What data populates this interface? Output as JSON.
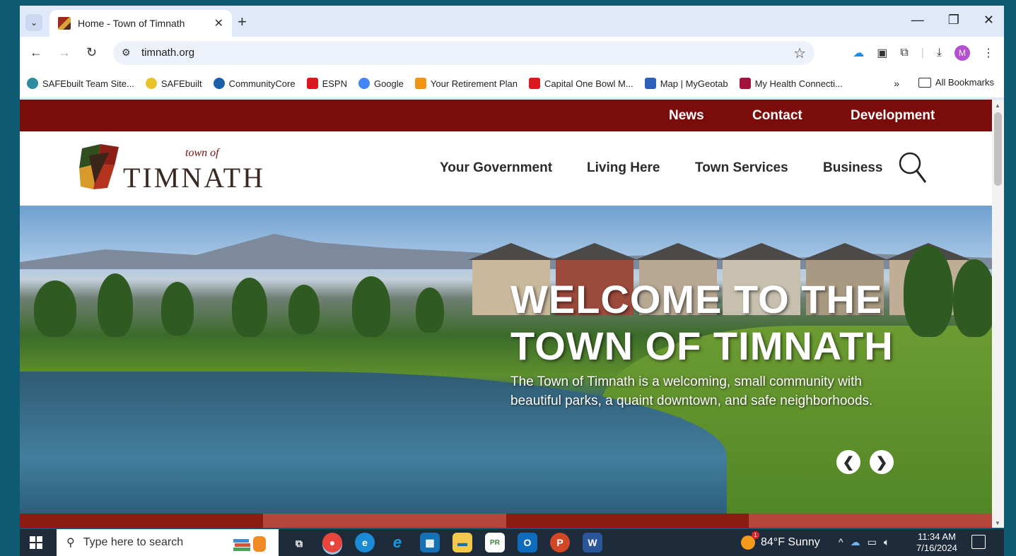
{
  "browser": {
    "tab_title": "Home - Town of Timnath",
    "tab_close": "✕",
    "new_tab": "+",
    "url": "timnath.org",
    "window": {
      "minimize": "—",
      "restore": "❐",
      "close": "✕"
    },
    "avatar_letter": "M",
    "bookmarks": [
      {
        "label": "SAFEbuilt Team Site...",
        "color": "#2d8c9e"
      },
      {
        "label": "SAFEbuilt",
        "color": "#e8c12b"
      },
      {
        "label": "CommunityCore",
        "color": "#1b5fab"
      },
      {
        "label": "ESPN",
        "color": "#d71920"
      },
      {
        "label": "Google",
        "color": "#4285f4"
      },
      {
        "label": "Your Retirement Plan",
        "color": "#f29314"
      },
      {
        "label": "Capital One Bowl M...",
        "color": "#d71920"
      },
      {
        "label": "Map | MyGeotab",
        "color": "#2f5fb8"
      },
      {
        "label": "My Health Connecti...",
        "color": "#a3123a"
      }
    ],
    "bookmarks_more": "»",
    "all_bookmarks": "All Bookmarks"
  },
  "site": {
    "top_links": [
      "News",
      "Contact",
      "Development"
    ],
    "logo": {
      "word": "TIMNATH",
      "script": "town of"
    },
    "nav": [
      "Your Government",
      "Living Here",
      "Town Services",
      "Business"
    ],
    "hero": {
      "title_line1": "WELCOME TO THE",
      "title_line2": "TOWN OF TIMNATH",
      "description": "The Town of Timnath is a welcoming, small community with beautiful parks, a quaint downtown, and safe neighborhoods.",
      "prev": "❮",
      "next": "❯"
    },
    "band_colors": [
      "#8b1a10",
      "#b5473a",
      "#8b1a10",
      "#b5473a"
    ],
    "colors": {
      "maroon": "#7a0c0c",
      "header_text": "#2b2b2b"
    }
  },
  "taskbar": {
    "search_placeholder": "Type here to search",
    "apps": [
      {
        "name": "task-view",
        "glyph": "⧉",
        "color": "transparent"
      },
      {
        "name": "chrome",
        "glyph": "●",
        "color": "#e8453c",
        "active": true
      },
      {
        "name": "edge",
        "glyph": "e",
        "color": "#1c8bd6"
      },
      {
        "name": "internet-explorer",
        "glyph": "e",
        "color": "#1b6ac2"
      },
      {
        "name": "store",
        "glyph": "▦",
        "color": "#1670b5"
      },
      {
        "name": "file-explorer",
        "glyph": "▬",
        "color": "#f2c94c"
      },
      {
        "name": "pr",
        "glyph": "PR",
        "color": "#3e7d3a"
      },
      {
        "name": "outlook",
        "glyph": "O",
        "color": "#0f6cbd"
      },
      {
        "name": "powerpoint",
        "glyph": "P",
        "color": "#d24726"
      },
      {
        "name": "word",
        "glyph": "W",
        "color": "#2b579a"
      }
    ],
    "weather": "84°F Sunny",
    "weather_badge": "1",
    "time": "11:34 AM",
    "date": "7/16/2024"
  }
}
